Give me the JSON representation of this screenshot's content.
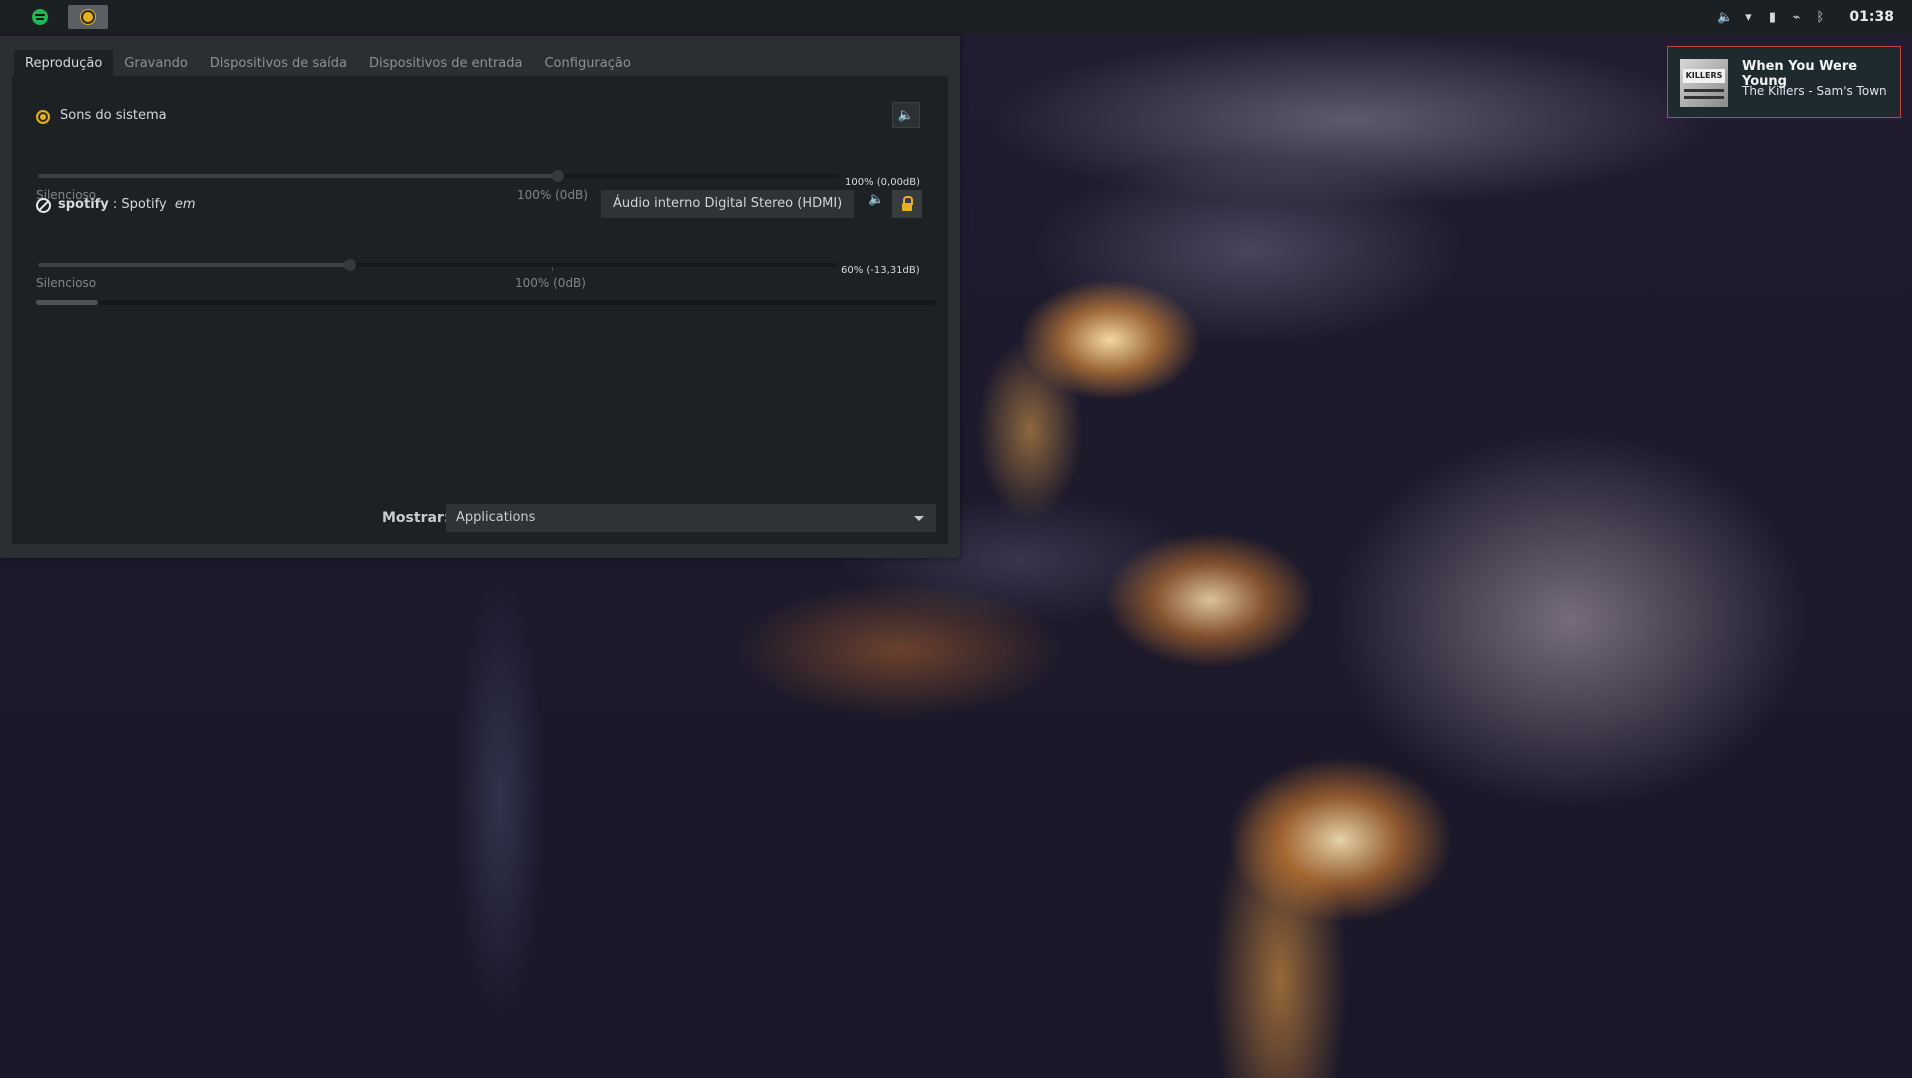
{
  "panel": {
    "tray_icons": [
      "volume-icon",
      "wifi-icon",
      "battery-icon",
      "clip-icon",
      "bluetooth-icon"
    ],
    "tray_glyphs": [
      "🔈",
      "▾",
      "▮",
      "⌁",
      "ᛒ"
    ],
    "clock": "01:38"
  },
  "notification": {
    "title": "When You Were Young",
    "body": "The Killers - Sam's Town",
    "art_text": "KILLERS"
  },
  "window": {
    "tabs": [
      "Reprodução",
      "Gravando",
      "Dispositivos de saída",
      "Dispositivos de entrada",
      "Configuração"
    ],
    "streams": [
      {
        "name": "Sons do sistema",
        "level_percent": 100,
        "level_text": "100% (0,00dB)",
        "silent_label": "Silencioso",
        "ref_label": "100% (0dB)"
      },
      {
        "name_bold": "spotify",
        "name_rest": " : Spotify",
        "name_em": "em",
        "device": "Áudio interno Digital Stereo (HDMI)",
        "level_percent": 60,
        "level_text": "60% (-13,31dB)",
        "silent_label": "Silencioso",
        "ref_label": "100% (0dB)"
      }
    ],
    "show_label": "Mostrar:",
    "show_value": "Applications"
  },
  "colors": {
    "accent": "#e6b11c",
    "notify_border": "#c4473f",
    "spotify_green": "#1db954"
  }
}
